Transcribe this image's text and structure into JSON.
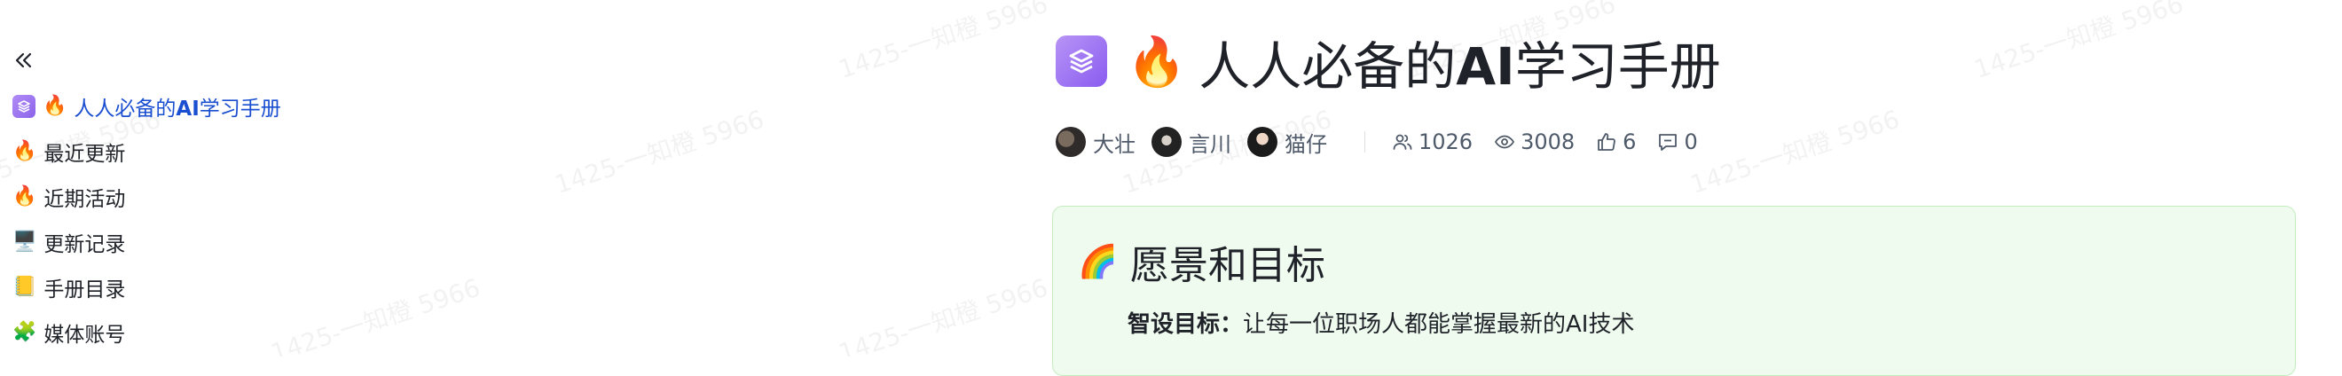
{
  "watermark": "1425-一知橙 5966",
  "sidebar": {
    "collapse_icon": "double-chevron-left-icon",
    "items": [
      {
        "icon": "wiki-stack-icon",
        "emoji": "🔥",
        "title_prefix": "人人必备的",
        "title_strong": "AI",
        "title_suffix": "学习手册",
        "active": true
      },
      {
        "emoji": "🔥",
        "label": "最近更新"
      },
      {
        "emoji": "🔥",
        "label": "近期活动"
      },
      {
        "emoji": "🖥️",
        "label": "更新记录"
      },
      {
        "emoji": "📒",
        "label": "手册目录"
      },
      {
        "emoji": "🧩",
        "label": "媒体账号"
      }
    ]
  },
  "page": {
    "badge_icon": "wiki-stack-icon",
    "title_emoji": "🔥",
    "title_prefix": "人人必备的",
    "title_strong": "AI",
    "title_suffix": "学习手册",
    "authors": [
      "大壮",
      "言川",
      "猫仔"
    ],
    "stats": {
      "members": "1026",
      "views": "3008",
      "likes": "6",
      "comments": "0"
    }
  },
  "card": {
    "emoji": "🌈",
    "heading": "愿景和目标",
    "label": "智设目标：",
    "text": "让每一位职场人都能掌握最新的AI技术"
  },
  "colors": {
    "active_link": "#1b4fd1",
    "card_bg": "#f0fbef",
    "card_border": "#c4ecbf",
    "badge": "#9b6ff2"
  }
}
